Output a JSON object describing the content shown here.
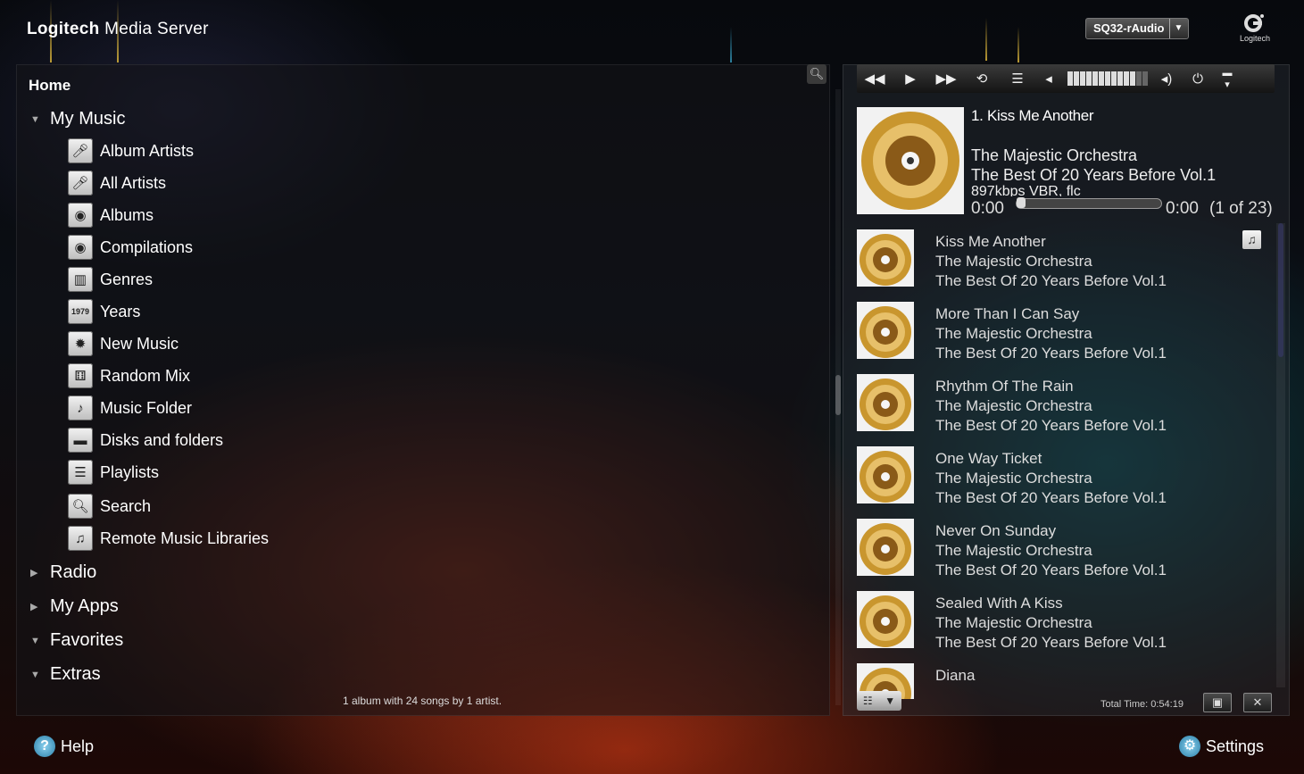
{
  "header": {
    "brand": "Logitech",
    "product": "Media Server",
    "player_name": "SQ32-rAudio",
    "logo_text": "Logitech"
  },
  "browse": {
    "home": "Home",
    "sections": {
      "my_music": "My Music",
      "radio": "Radio",
      "my_apps": "My Apps",
      "favorites": "Favorites",
      "extras": "Extras"
    },
    "items": [
      {
        "label": "Album Artists",
        "icon": "artist-icon"
      },
      {
        "label": "All Artists",
        "icon": "artist-icon"
      },
      {
        "label": "Albums",
        "icon": "albums-icon"
      },
      {
        "label": "Compilations",
        "icon": "albums-icon"
      },
      {
        "label": "Genres",
        "icon": "piano-icon"
      },
      {
        "label": "Years",
        "icon": "calendar-icon"
      },
      {
        "label": "New Music",
        "icon": "new-music-icon"
      },
      {
        "label": "Random Mix",
        "icon": "dice-icon"
      },
      {
        "label": "Music Folder",
        "icon": "music-folder-icon"
      },
      {
        "label": "Disks and folders",
        "icon": "folder-icon"
      },
      {
        "label": "Playlists",
        "icon": "playlist-icon"
      },
      {
        "label": "Search",
        "icon": "search-icon"
      },
      {
        "label": "Remote Music Libraries",
        "icon": "remote-library-icon"
      }
    ],
    "years_badge": "1979",
    "status": "1 album with 24 songs by 1 artist."
  },
  "now_playing": {
    "title": "1. Kiss Me Another",
    "artist": "The Majestic Orchestra",
    "album": "The Best Of 20 Years Before Vol.1",
    "bitrate": "897kbps VBR, flc",
    "elapsed": "0:00",
    "remaining": "0:00",
    "count": "(1 of 23)",
    "progress": 0
  },
  "playlist": [
    {
      "title": "Kiss Me Another",
      "artist": "The Majestic Orchestra",
      "album": "The Best Of 20 Years Before Vol.1"
    },
    {
      "title": "More Than I Can Say",
      "artist": "The Majestic Orchestra",
      "album": "The Best Of 20 Years Before Vol.1"
    },
    {
      "title": "Rhythm Of The Rain",
      "artist": "The Majestic Orchestra",
      "album": "The Best Of 20 Years Before Vol.1"
    },
    {
      "title": "One Way Ticket",
      "artist": "The Majestic Orchestra",
      "album": "The Best Of 20 Years Before Vol.1"
    },
    {
      "title": "Never On Sunday",
      "artist": "The Majestic Orchestra",
      "album": "The Best Of 20 Years Before Vol.1"
    },
    {
      "title": "Sealed With A Kiss",
      "artist": "The Majestic Orchestra",
      "album": "The Best Of 20 Years Before Vol.1"
    },
    {
      "title": "Diana",
      "artist": "",
      "album": ""
    }
  ],
  "playlist_footer": {
    "total_time": "Total Time: 0:54:19"
  },
  "footer": {
    "help": "Help",
    "settings": "Settings"
  },
  "volume_level": 0.85,
  "colors": {
    "accent_blue": "#2a7fa8",
    "disc_gold": "#c9962e"
  }
}
